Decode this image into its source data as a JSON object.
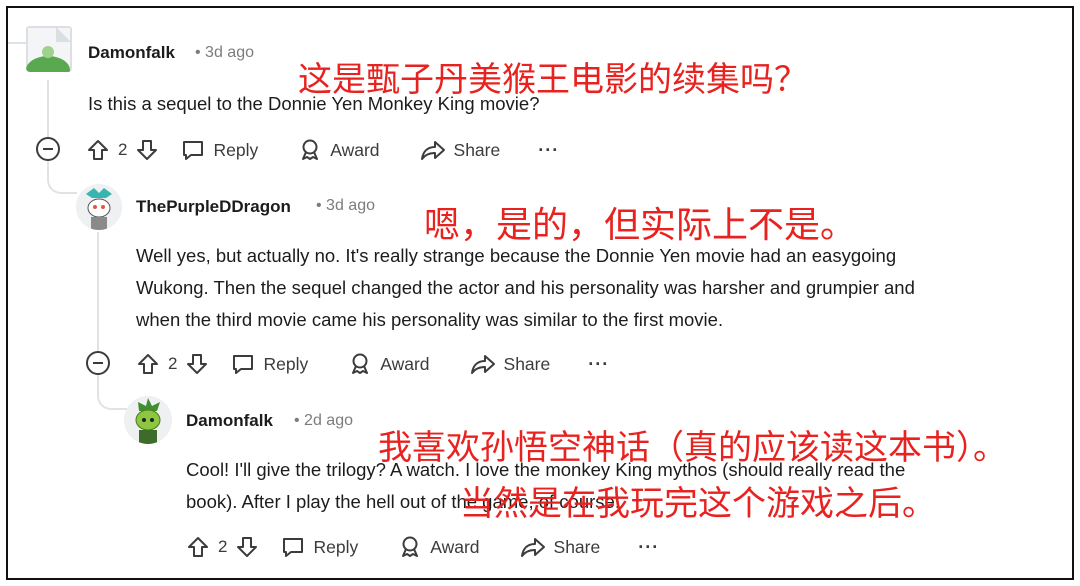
{
  "comments": [
    {
      "username": "Damonfalk",
      "time": "• 3d ago",
      "body": "Is this a sequel to the Donnie Yen Monkey King movie?",
      "votes": "2",
      "translation": "这是甄子丹美猴王电影的续集吗？"
    },
    {
      "username": "ThePurpleDDragon",
      "time": "• 3d ago",
      "body_lines": [
        "Well yes, but actually no. It's really strange because the Donnie Yen movie had an easygoing",
        "Wukong. Then the sequel changed the actor and his personality was harsher and grumpier and",
        "when the third movie came his personality was similar to the first movie."
      ],
      "votes": "2",
      "translation": "嗯，是的，但实际上不是。"
    },
    {
      "username": "Damonfalk",
      "time": "• 2d ago",
      "body_lines": [
        "Cool! I'll give the trilogy? A watch. I love the monkey King mythos (should really read the",
        "book). After I play the hell out of the game, of course."
      ],
      "votes": "2",
      "translation_lines": [
        "我喜欢孙悟空神话（真的应该读这本书）。",
        "当然是在我玩完这个游戏之后。"
      ]
    }
  ],
  "actions": {
    "reply": "Reply",
    "award": "Award",
    "share": "Share",
    "more": "···"
  },
  "colors": {
    "translation": "#e8221f",
    "thread_line": "#e0e3e6",
    "meta": "#7c7c7c"
  },
  "icons": [
    "upvote-icon",
    "downvote-icon",
    "reply-bubble-icon",
    "award-icon",
    "share-icon",
    "collapse-icon"
  ]
}
